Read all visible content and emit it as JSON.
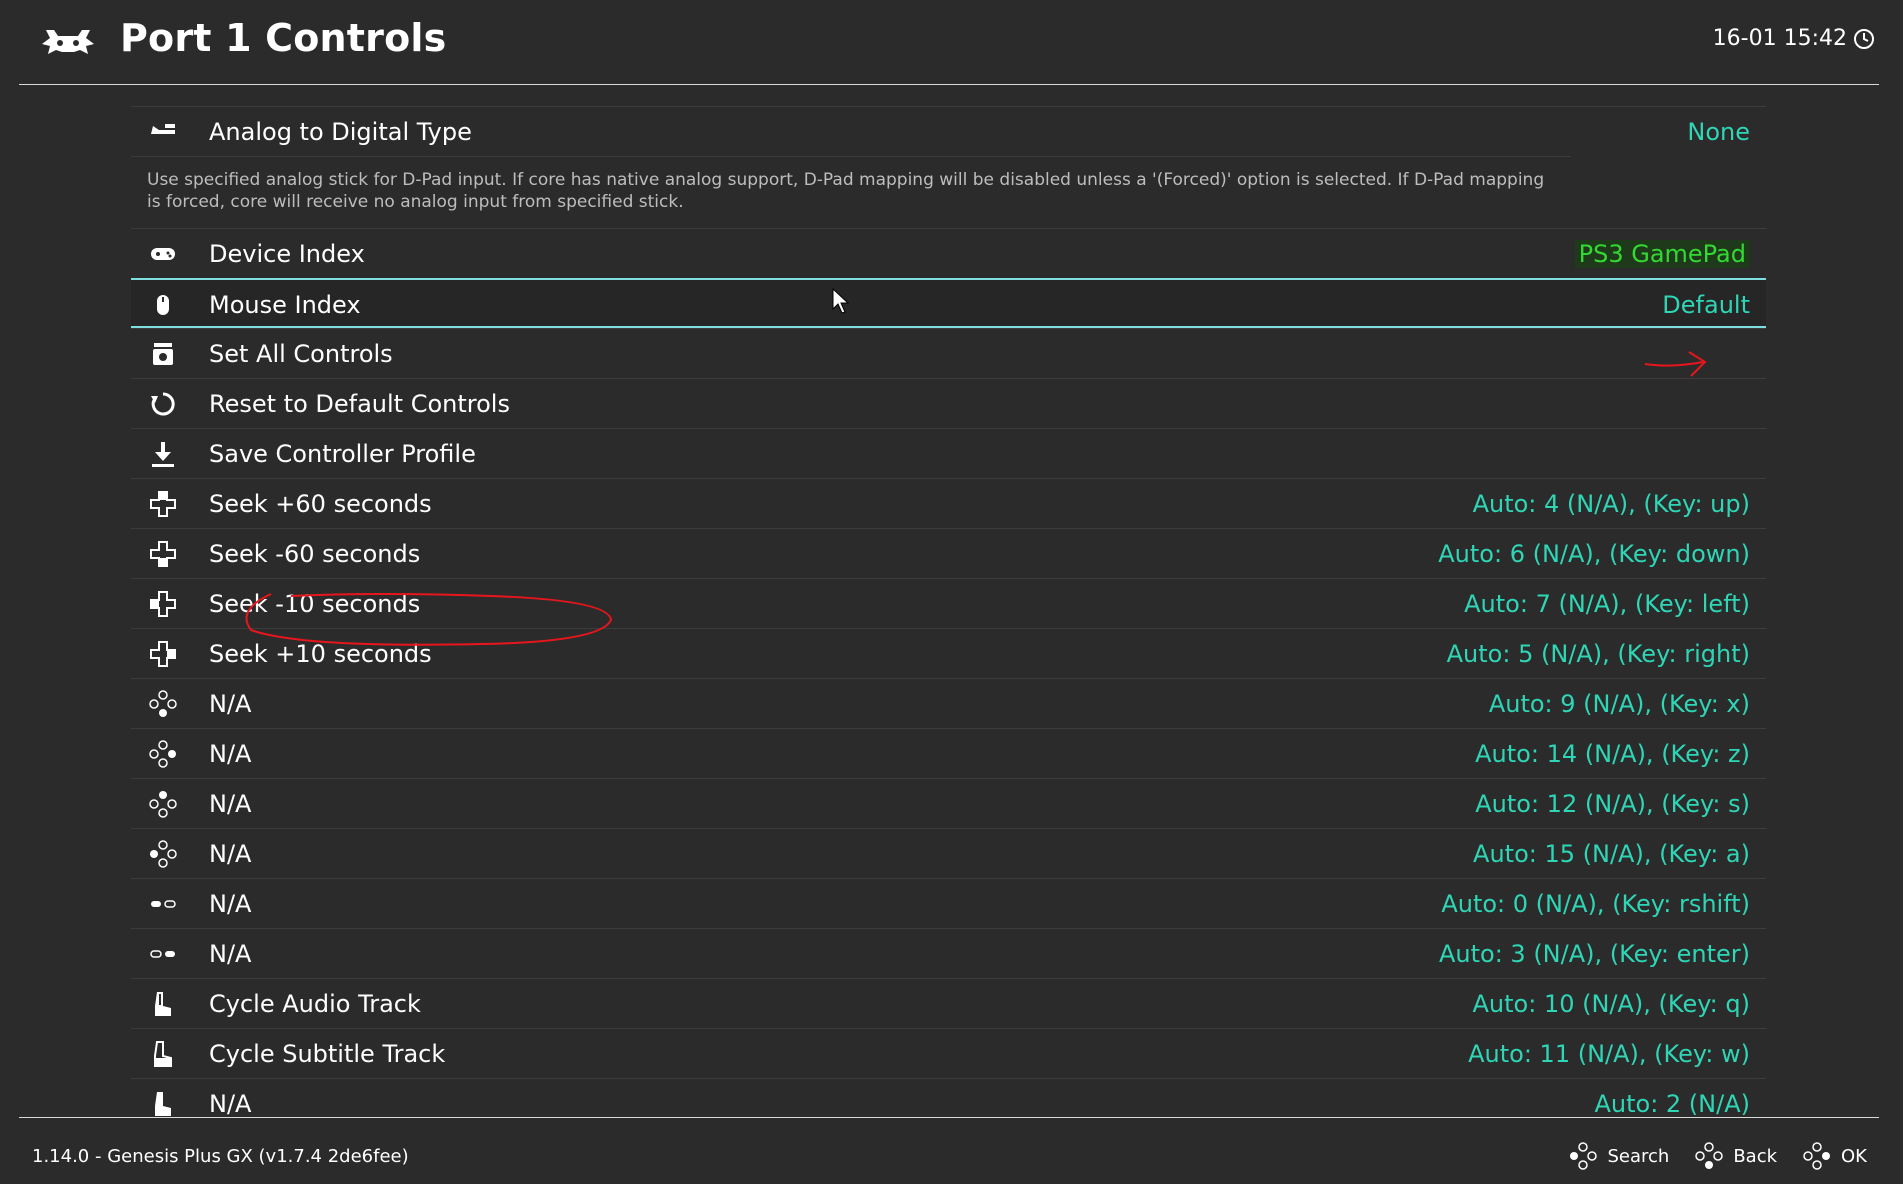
{
  "header": {
    "title": "Port 1 Controls",
    "datetime": "16-01 15:42"
  },
  "colors": {
    "background": "#2b2b2b",
    "value": "#2ed6b6",
    "selection_border": "#7fdfe0",
    "annotation": "#e8161c",
    "device_highlight": "#33d933"
  },
  "rows": [
    {
      "icon": "analog-stick-icon",
      "label": "Analog to Digital Type",
      "value": "None"
    },
    {
      "icon": "gamepad-icon",
      "label": "Device Index",
      "value": "PS3 GamePad"
    },
    {
      "icon": "mouse-icon",
      "label": "Mouse Index",
      "value": "Default"
    },
    {
      "icon": "controller-stack-icon",
      "label": "Set All Controls",
      "value": ""
    },
    {
      "icon": "reset-icon",
      "label": "Reset to Default Controls",
      "value": ""
    },
    {
      "icon": "download-icon",
      "label": "Save Controller Profile",
      "value": ""
    },
    {
      "icon": "dpad-up-icon",
      "label": "Seek +60 seconds",
      "value": "Auto: 4 (N/A), (Key: up)"
    },
    {
      "icon": "dpad-down-icon",
      "label": "Seek -60 seconds",
      "value": "Auto: 6 (N/A), (Key: down)"
    },
    {
      "icon": "dpad-left-icon",
      "label": "Seek -10 seconds",
      "value": "Auto: 7 (N/A), (Key: left)"
    },
    {
      "icon": "dpad-right-icon",
      "label": "Seek +10 seconds",
      "value": "Auto: 5 (N/A), (Key: right)"
    },
    {
      "icon": "face-button-bottom-icon",
      "label": "N/A",
      "value": "Auto: 9 (N/A), (Key: x)"
    },
    {
      "icon": "face-button-right-icon",
      "label": "N/A",
      "value": "Auto: 14 (N/A), (Key: z)"
    },
    {
      "icon": "face-button-top-icon",
      "label": "N/A",
      "value": "Auto: 12 (N/A), (Key: s)"
    },
    {
      "icon": "face-button-left-icon",
      "label": "N/A",
      "value": "Auto: 15 (N/A), (Key: a)"
    },
    {
      "icon": "select-button-icon",
      "label": "N/A",
      "value": "Auto: 0 (N/A), (Key: rshift)"
    },
    {
      "icon": "start-button-icon",
      "label": "N/A",
      "value": "Auto: 3 (N/A), (Key: enter)"
    },
    {
      "icon": "left-shoulder-icon",
      "label": "Cycle Audio Track",
      "value": "Auto: 10 (N/A), (Key: q)"
    },
    {
      "icon": "right-shoulder-icon",
      "label": "Cycle Subtitle Track",
      "value": "Auto: 11 (N/A), (Key: w)"
    },
    {
      "icon": "left-trigger-icon",
      "label": "N/A",
      "value": "Auto: 2 (N/A)"
    }
  ],
  "description": "Use specified analog stick for D-Pad input. If core has native analog support, D-Pad mapping will be disabled unless a '(Forced)' option is selected. If D-Pad mapping is forced, core will receive no analog input from specified stick.",
  "footer": {
    "version": "1.14.0 - Genesis Plus GX (v1.7.4 2de6fee)",
    "buttons": [
      {
        "icon": "face-button-left-icon",
        "label": "Search"
      },
      {
        "icon": "face-button-bottom-icon",
        "label": "Back"
      },
      {
        "icon": "face-button-right-icon",
        "label": "OK"
      }
    ]
  }
}
